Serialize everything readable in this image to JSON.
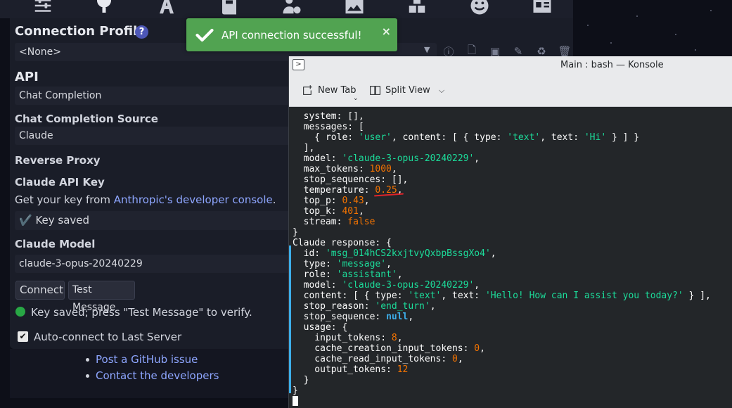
{
  "toast": {
    "message": "API connection successful!",
    "close_glyph": "×"
  },
  "settings": {
    "connection_profile_title": "Connection Profile",
    "help_glyph": "?",
    "connection_profile_value": "<None>",
    "api_title": "API",
    "api_value": "Chat Completion",
    "source_title": "Chat Completion Source",
    "source_value": "Claude",
    "reverse_proxy_title": "Reverse Proxy",
    "api_key_title": "Claude API Key",
    "get_key_prefix": "Get your key from ",
    "get_key_link": "Anthropic's developer console",
    "get_key_suffix": ".",
    "key_saved_value": "✔️ Key saved",
    "model_title": "Claude Model",
    "model_value": "claude-3-opus-20240229",
    "connect_button": "Connect",
    "test_button": "Test Message",
    "status_text": "Key saved; press \"Test Message\" to verify.",
    "auto_connect_label": "Auto-connect to Last Server",
    "auto_connect_checked": true,
    "links": [
      "Post a GitHub issue",
      "Contact the developers"
    ]
  },
  "konsole": {
    "window_title": "Main : bash — Konsole",
    "new_tab_label": "New Tab",
    "split_view_label": "Split View",
    "lines": [
      [
        [
          "  system: [],",
          "k"
        ]
      ],
      [
        [
          "  messages: [",
          "k"
        ]
      ],
      [
        [
          "    { role: ",
          "k"
        ],
        [
          "'user'",
          "s"
        ],
        [
          ", content: [ { type: ",
          "k"
        ],
        [
          "'text'",
          "s"
        ],
        [
          ", text: ",
          "k"
        ],
        [
          "'Hi'",
          "s"
        ],
        [
          " } ] }",
          "k"
        ]
      ],
      [
        [
          "  ],",
          "k"
        ]
      ],
      [
        [
          "  model: ",
          "k"
        ],
        [
          "'claude-3-opus-20240229'",
          "s"
        ],
        [
          ",",
          "k"
        ]
      ],
      [
        [
          "  max_tokens: ",
          "k"
        ],
        [
          "1000",
          "n"
        ],
        [
          ",",
          "k"
        ]
      ],
      [
        [
          "  stop_sequences: [],",
          "k"
        ]
      ],
      [
        [
          "  temperature: ",
          "k"
        ],
        [
          "0.25",
          "n"
        ],
        [
          ",",
          "k"
        ]
      ],
      [
        [
          "  top_p: ",
          "k"
        ],
        [
          "0.43",
          "n"
        ],
        [
          ",",
          "k"
        ]
      ],
      [
        [
          "  top_k: ",
          "k"
        ],
        [
          "401",
          "n"
        ],
        [
          ",",
          "k"
        ]
      ],
      [
        [
          "  stream: ",
          "k"
        ],
        [
          "false",
          "b"
        ]
      ],
      [
        [
          "}",
          "k"
        ]
      ],
      [
        [
          "Claude response: {",
          "k"
        ]
      ],
      [
        [
          "  id: ",
          "k"
        ],
        [
          "'msg_014hCS2kxjtvyQxbpBssgXo4'",
          "s"
        ],
        [
          ",",
          "k"
        ]
      ],
      [
        [
          "  type: ",
          "k"
        ],
        [
          "'message'",
          "s"
        ],
        [
          ",",
          "k"
        ]
      ],
      [
        [
          "  role: ",
          "k"
        ],
        [
          "'assistant'",
          "s"
        ],
        [
          ",",
          "k"
        ]
      ],
      [
        [
          "  model: ",
          "k"
        ],
        [
          "'claude-3-opus-20240229'",
          "s"
        ],
        [
          ",",
          "k"
        ]
      ],
      [
        [
          "  content: [ { type: ",
          "k"
        ],
        [
          "'text'",
          "s"
        ],
        [
          ", text: ",
          "k"
        ],
        [
          "'Hello! How can I assist you today?'",
          "s"
        ],
        [
          " } ],",
          "k"
        ]
      ],
      [
        [
          "  stop_reason: ",
          "k"
        ],
        [
          "'end_turn'",
          "s"
        ],
        [
          ",",
          "k"
        ]
      ],
      [
        [
          "  stop_sequence: ",
          "k"
        ],
        [
          "null",
          "null"
        ],
        [
          ",",
          "k"
        ]
      ],
      [
        [
          "  usage: {",
          "k"
        ]
      ],
      [
        [
          "    input_tokens: ",
          "k"
        ],
        [
          "8",
          "n"
        ],
        [
          ",",
          "k"
        ]
      ],
      [
        [
          "    cache_creation_input_tokens: ",
          "k"
        ],
        [
          "0",
          "n"
        ],
        [
          ",",
          "k"
        ]
      ],
      [
        [
          "    cache_read_input_tokens: ",
          "k"
        ],
        [
          "0",
          "n"
        ],
        [
          ",",
          "k"
        ]
      ],
      [
        [
          "    output_tokens: ",
          "k"
        ],
        [
          "12",
          "n"
        ]
      ],
      [
        [
          "  }",
          "k"
        ]
      ],
      [
        [
          "}",
          "k"
        ]
      ]
    ]
  },
  "colors": {
    "toast_bg": "#51a351",
    "terminal_bg": "#232629",
    "string": "#1cdc9a",
    "number": "#f67400",
    "null": "#3daee9",
    "link": "#8ea6ff",
    "annotation": "#e0242a"
  },
  "icons": {
    "top_nav": [
      "sliders-icon",
      "plug-icon",
      "font-icon",
      "book-icon",
      "user-gear-icon",
      "image-icon",
      "cubes-icon",
      "smile-icon",
      "id-card-icon"
    ],
    "profile_actions": [
      "info-icon",
      "file-add-icon",
      "save-icon",
      "edit-icon",
      "recycle-icon",
      "trash-icon"
    ]
  }
}
